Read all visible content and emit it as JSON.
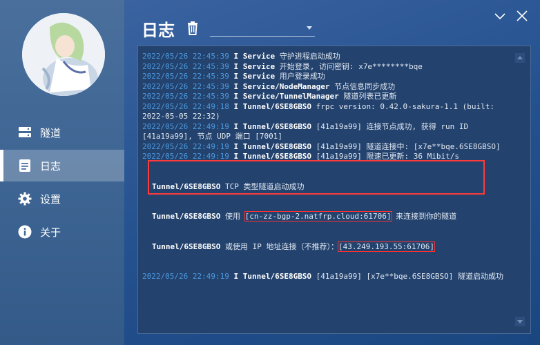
{
  "nav": [
    {
      "label": "隧道",
      "icon": "server-icon"
    },
    {
      "label": "日志",
      "icon": "document-icon",
      "active": true
    },
    {
      "label": "设置",
      "icon": "gear-icon"
    },
    {
      "label": "关于",
      "icon": "info-icon"
    }
  ],
  "header": {
    "title": "日志",
    "select_value": ""
  },
  "colors": {
    "sidebar": "#3f6694",
    "main": "#24518f",
    "log_bg": "#23426d",
    "timestamp": "#4c9ae0",
    "highlight": "#ff3b3b"
  },
  "log_lines": [
    {
      "ts": "2022/05/26 22:45:39",
      "lv": "I",
      "src": "Service",
      "msg": " 守护进程启动成功"
    },
    {
      "ts": "2022/05/26 22:45:39",
      "lv": "I",
      "src": "Service",
      "msg": " 开始登录, 访问密钥: x7e********bqe"
    },
    {
      "ts": "2022/05/26 22:45:39",
      "lv": "I",
      "src": "Service",
      "msg": " 用户登录成功"
    },
    {
      "ts": "2022/05/26 22:45:39",
      "lv": "I",
      "src": "Service/NodeManager",
      "msg": " 节点信息同步成功"
    },
    {
      "ts": "2022/05/26 22:45:39",
      "lv": "I",
      "src": "Service/TunnelManager",
      "msg": " 隧道列表已更新"
    },
    {
      "ts": "2022/05/26 22:49:18",
      "lv": "I",
      "src": "Tunnel/6SE8GBSO",
      "msg": " frpc version: 0.42.0-sakura-1.1 (built: 2022-05-05 22:32)"
    },
    {
      "ts": "2022/05/26 22:49:19",
      "lv": "I",
      "src": "Tunnel/6SE8GBSO",
      "msg": " [41a19a99] 连接节点成功, 获得 run ID [41a19a99], 节点 UDP 端口 [7001]"
    },
    {
      "ts": "2022/05/26 22:49:19",
      "lv": "I",
      "src": "Tunnel/6SE8GBSO",
      "msg": " [41a19a99] 隧道连接中: [x7e**bqe.6SE8GBSO]"
    },
    {
      "ts": "2022/05/26 22:49:19",
      "lv": "I",
      "src": "Tunnel/6SE8GBSO",
      "msg": " [41a19a99] 限速已更新: 36 Mibit/s"
    }
  ],
  "highlight_lines": [
    {
      "src": "Tunnel/6SE8GBSO",
      "msg": " TCP 类型隧道启动成功"
    },
    {
      "src": "Tunnel/6SE8GBSO",
      "pre": " 使用 ",
      "boxed": "[cn-zz-bgp-2.natfrp.cloud:61706]",
      "post": " 来连接到你的隧道"
    },
    {
      "src": "Tunnel/6SE8GBSO",
      "pre": " 或使用 IP 地址连接（不推荐）：",
      "boxed": "[43.249.193.55:61706]",
      "post": ""
    }
  ],
  "last_line": {
    "ts": "2022/05/26 22:49:19",
    "lv": "I",
    "src": "Tunnel/6SE8GBSO",
    "msg": " [41a19a99] [x7e**bqe.6SE8GBSO] 隧道启动成功"
  }
}
